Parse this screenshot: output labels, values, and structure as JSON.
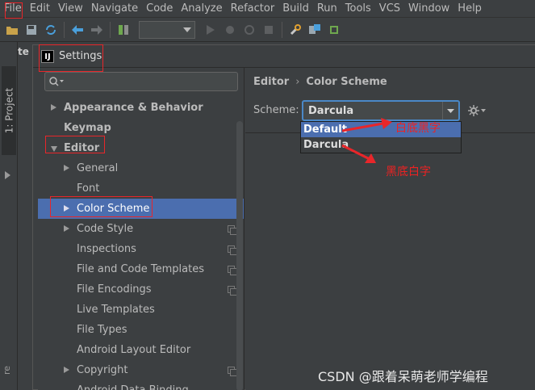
{
  "menu": [
    "File",
    "Edit",
    "View",
    "Navigate",
    "Code",
    "Analyze",
    "Refactor",
    "Build",
    "Run",
    "Tools",
    "VCS",
    "Window",
    "Help"
  ],
  "project_tab": "te",
  "left_strip": {
    "project": "1: Project",
    "bottom": "re"
  },
  "dialog": {
    "title": "Settings",
    "logo_letters": "IJ",
    "search_icon": "search-icon",
    "tree": [
      {
        "label": "Appearance & Behavior",
        "level": 0,
        "arrow": "right",
        "bold": true
      },
      {
        "label": "Keymap",
        "level": 0,
        "arrow": "none",
        "bold": true
      },
      {
        "label": "Editor",
        "level": 0,
        "arrow": "down",
        "bold": true
      },
      {
        "label": "General",
        "level": 1,
        "arrow": "right"
      },
      {
        "label": "Font",
        "level": 1,
        "arrow": "none"
      },
      {
        "label": "Color Scheme",
        "level": 1,
        "arrow": "right",
        "selected": true
      },
      {
        "label": "Code Style",
        "level": 1,
        "arrow": "right",
        "copy": true
      },
      {
        "label": "Inspections",
        "level": 1,
        "arrow": "none",
        "copy": true
      },
      {
        "label": "File and Code Templates",
        "level": 1,
        "arrow": "none",
        "copy": true
      },
      {
        "label": "File Encodings",
        "level": 1,
        "arrow": "none",
        "copy": true
      },
      {
        "label": "Live Templates",
        "level": 1,
        "arrow": "none"
      },
      {
        "label": "File Types",
        "level": 1,
        "arrow": "none"
      },
      {
        "label": "Android Layout Editor",
        "level": 1,
        "arrow": "none"
      },
      {
        "label": "Copyright",
        "level": 1,
        "arrow": "right",
        "copy": true
      },
      {
        "label": "Android Data Binding",
        "level": 1,
        "arrow": "none"
      }
    ],
    "breadcrumb": {
      "parent": "Editor",
      "separator": "›",
      "current": "Color Scheme"
    },
    "scheme": {
      "label": "Scheme:",
      "value": "Darcula",
      "options": [
        "Default",
        "Darcula"
      ],
      "highlighted": "Default"
    }
  },
  "annotations": {
    "default_note": "白底黑字",
    "darcula_note": "黑底白字",
    "color": "#e8262a"
  },
  "watermark": "CSDN @跟着呆萌老师学编程",
  "colors": {
    "background": "#3c3f41",
    "selection": "#4b6eaf",
    "focus": "#4a88c7"
  }
}
